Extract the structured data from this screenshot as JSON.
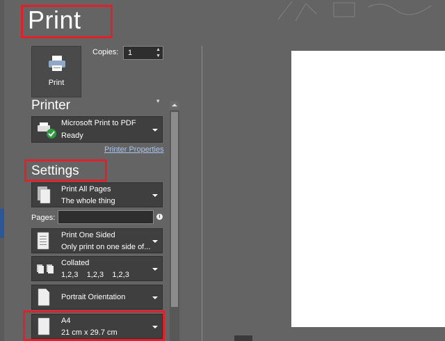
{
  "title": "Print",
  "print_button": {
    "label": "Print",
    "icon": "printer-icon"
  },
  "copies": {
    "label": "Copies:",
    "value": "1"
  },
  "printer": {
    "section_title": "Printer",
    "name": "Microsoft Print to PDF",
    "status": "Ready",
    "properties_link": "Printer Properties"
  },
  "settings": {
    "section_title": "Settings",
    "range": {
      "line1": "Print All Pages",
      "line2": "The whole thing"
    },
    "pages": {
      "label": "Pages:",
      "value": "",
      "info_icon": "info-icon"
    },
    "sides": {
      "line1": "Print One Sided",
      "line2": "Only print on one side of..."
    },
    "collation": {
      "line1": "Collated",
      "line2": "1,2,3    1,2,3    1,2,3"
    },
    "orientation": {
      "line1": "Portrait Orientation"
    },
    "paper": {
      "line1": "A4",
      "line2": "21 cm x 29.7 cm"
    }
  },
  "colors": {
    "highlight": "#e0202a",
    "panel": "#646464",
    "control": "#3f3f3f",
    "link": "#a8c4ef"
  }
}
